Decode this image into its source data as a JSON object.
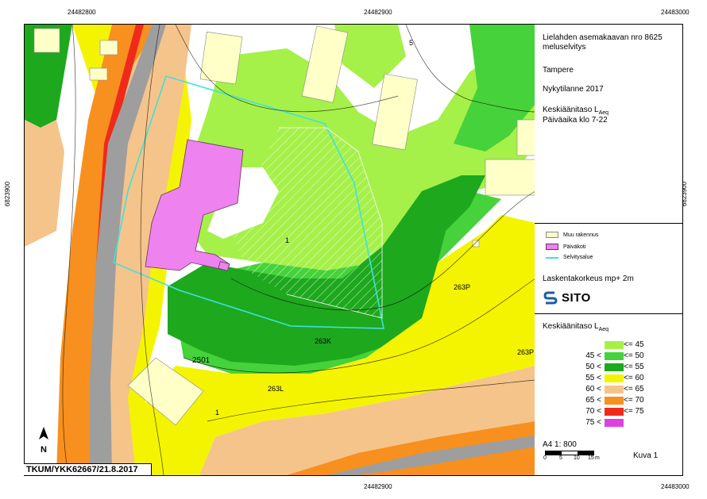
{
  "coordinates": {
    "x_top_left": "24482800",
    "x_top_mid": "24482900",
    "x_top_right": "24483000",
    "x_bottom_mid": "24482900",
    "x_bottom_right": "24483000",
    "y_left": "6823900",
    "y_right": "6823900"
  },
  "legend": {
    "title_line1": "Lielahden asemakaavan nro 8625",
    "title_line2": "meluselvitys",
    "location": "Tampere",
    "scenario": "Nykytilanne 2017",
    "metric_line1": "Keskiäänitaso L",
    "metric_sub": "Aeq",
    "metric_line2": "Päiväaika klo 7-22",
    "symbols": [
      {
        "label": "Muu rakennus",
        "color": "#ffffc8"
      },
      {
        "label": "Päiväkoti",
        "color": "#ee82ee"
      },
      {
        "label": "Selvitysalue",
        "color": "#40e0e0"
      }
    ],
    "height_text": "Laskentakorkeus mp+ 2m",
    "logo_text": "SITO",
    "scale_title": "Keskiäänitaso L",
    "scale_sub": "Aeq",
    "levels": [
      {
        "low": "",
        "high": "<= 45",
        "color": "#a6f04a"
      },
      {
        "low": "45 <",
        "high": "<= 50",
        "color": "#46d23a"
      },
      {
        "low": "50 <",
        "high": "<= 55",
        "color": "#1ea81e"
      },
      {
        "low": "55 <",
        "high": "<= 60",
        "color": "#f4f400"
      },
      {
        "low": "60 <",
        "high": "<= 65",
        "color": "#f5c48a"
      },
      {
        "low": "65 <",
        "high": "<= 70",
        "color": "#f7901e"
      },
      {
        "low": "70 <",
        "high": "<= 75",
        "color": "#f02a1a"
      },
      {
        "low": "75 <",
        "high": "",
        "color": "#e040e0"
      }
    ],
    "map_scale": "A4 1: 800",
    "scale_ticks": [
      "0",
      "5",
      "10",
      "15"
    ],
    "scale_unit": "m",
    "figure": "Kuva 1"
  },
  "map_labels": {
    "l_5": "5",
    "l_1a": "1",
    "l_263P_a": "263P",
    "l_263K": "263K",
    "l_263P_b": "263P",
    "l_2501": "2501",
    "l_263L": "263L",
    "l_1b": "1"
  },
  "stamp": "TKUM/YKK62667/21.8.2017"
}
